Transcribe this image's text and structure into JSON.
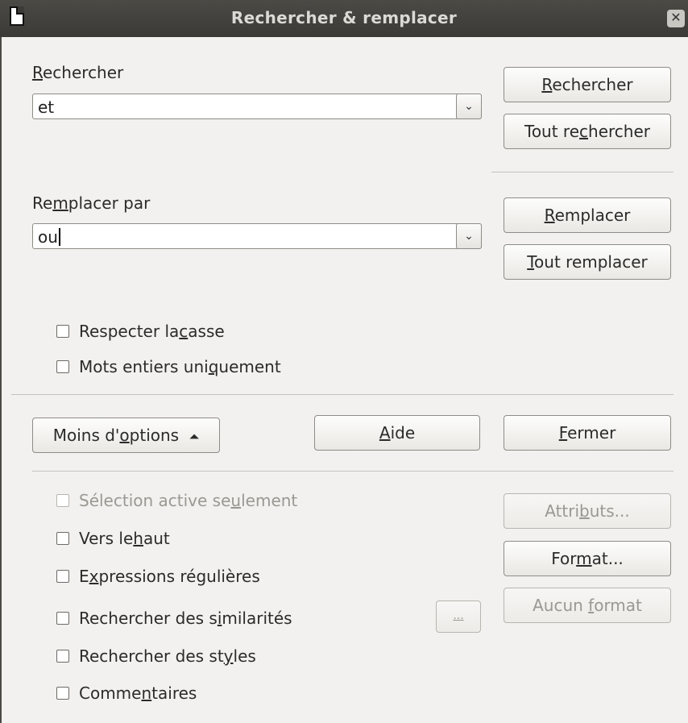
{
  "window": {
    "title": "Rechercher & remplacer",
    "close_glyph": "✕"
  },
  "search": {
    "label_u": "R",
    "label_rest": "echercher",
    "value": "et"
  },
  "replace": {
    "label_pre": "Re",
    "label_u": "m",
    "label_rest": "placer par",
    "value": "ou"
  },
  "buttons": {
    "rechercher": {
      "u": "R",
      "rest": "echercher"
    },
    "tout_rechercher": {
      "pre": "Tout re",
      "u": "c",
      "rest": "hercher"
    },
    "remplacer": {
      "u": "R",
      "rest": "emplacer"
    },
    "tout_remplacer": {
      "u": "T",
      "rest": "out remplacer"
    },
    "moins_options": {
      "pre": "Moins d'",
      "u": "o",
      "rest": "ptions",
      "arrow": "⏶"
    },
    "aide": {
      "u": "A",
      "rest": "ide"
    },
    "fermer": {
      "u": "F",
      "rest": "ermer"
    },
    "attributs": {
      "pre": "Attri",
      "u": "b",
      "rest": "uts..."
    },
    "format": {
      "pre": "For",
      "u": "m",
      "rest": "at..."
    },
    "aucun_format": {
      "pre": "Aucun ",
      "u": "f",
      "rest": "ormat"
    },
    "ellipsis": "..."
  },
  "options_top": [
    {
      "pre": "Respecter la ",
      "u": "c",
      "rest": "asse"
    },
    {
      "pre": "Mots entiers uni",
      "u": "q",
      "rest": "uement"
    }
  ],
  "options_more": [
    {
      "pre": "Sélection active se",
      "u": "u",
      "rest": "lement",
      "disabled": true
    },
    {
      "pre": "Vers le ",
      "u": "h",
      "rest": "aut"
    },
    {
      "pre": "E",
      "u": "x",
      "rest": "pressions régulières"
    },
    {
      "pre": "Rechercher des s",
      "u": "i",
      "rest": "milarités"
    },
    {
      "pre": "Rechercher des st",
      "u": "y",
      "rest": "les"
    },
    {
      "pre": "Comme",
      "u": "n",
      "rest": "taires"
    }
  ],
  "colors": {
    "titlebar": "#3b3a36",
    "cursor": "#c0262b"
  }
}
